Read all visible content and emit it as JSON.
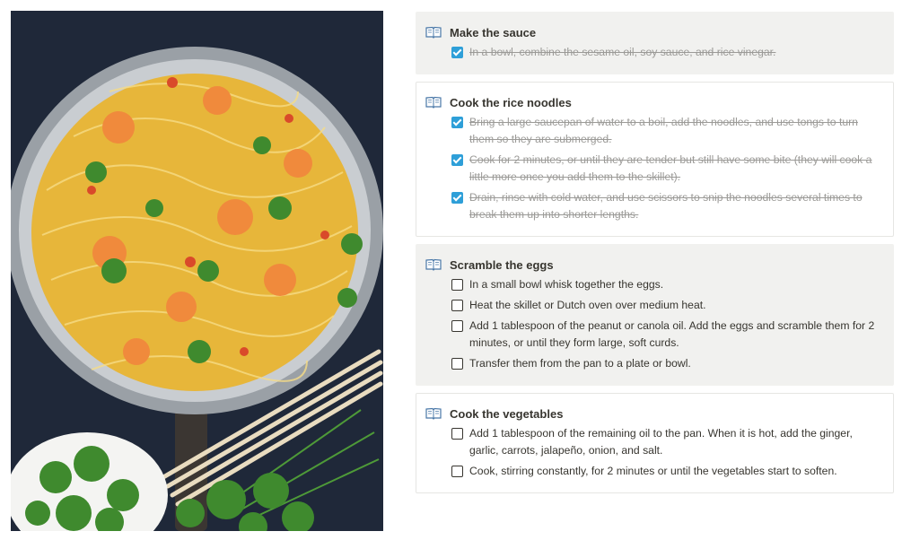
{
  "sections": [
    {
      "title": "Make the sauce",
      "items": [
        {
          "text": "In a bowl, combine the sesame oil, soy sauce, and rice vinegar.",
          "checked": true
        }
      ]
    },
    {
      "title": "Cook the rice noodles",
      "items": [
        {
          "text": "Bring a large saucepan of water to a boil, add the noodles, and use tongs to turn them so they are submerged.",
          "checked": true
        },
        {
          "text": "Cook for 2 minutes, or until they are tender but still have some bite (they will cook a little more once you add them to the skillet).",
          "checked": true
        },
        {
          "text": "Drain, rinse with cold water, and use scissors to snip the noodles several times to break them up into shorter lengths.",
          "checked": true
        }
      ]
    },
    {
      "title": "Scramble the eggs",
      "items": [
        {
          "text": "In a small bowl whisk together the eggs.",
          "checked": false
        },
        {
          "text": "Heat the skillet or Dutch oven over medium heat.",
          "checked": false
        },
        {
          "text": "Add 1 tablespoon of the peanut or canola oil. Add the eggs and scramble them for 2 minutes, or until they form large, soft curds.",
          "checked": false
        },
        {
          "text": "Transfer them from the pan to a plate or bowl.",
          "checked": false
        }
      ]
    },
    {
      "title": "Cook the vegetables",
      "items": [
        {
          "text": "Add 1 tablespoon of the remaining oil to the pan. When it is hot, add the ginger, garlic, carrots, jalapeño, onion, and salt.",
          "checked": false
        },
        {
          "text": "Cook, stirring constantly, for 2 minutes or until the vegetables start to soften.",
          "checked": false
        }
      ]
    }
  ],
  "colors": {
    "checkbox_checked": "#2e9fd8",
    "section_shaded": "#f1f1ef",
    "text": "#37352f",
    "done_text": "#9b9a97"
  }
}
